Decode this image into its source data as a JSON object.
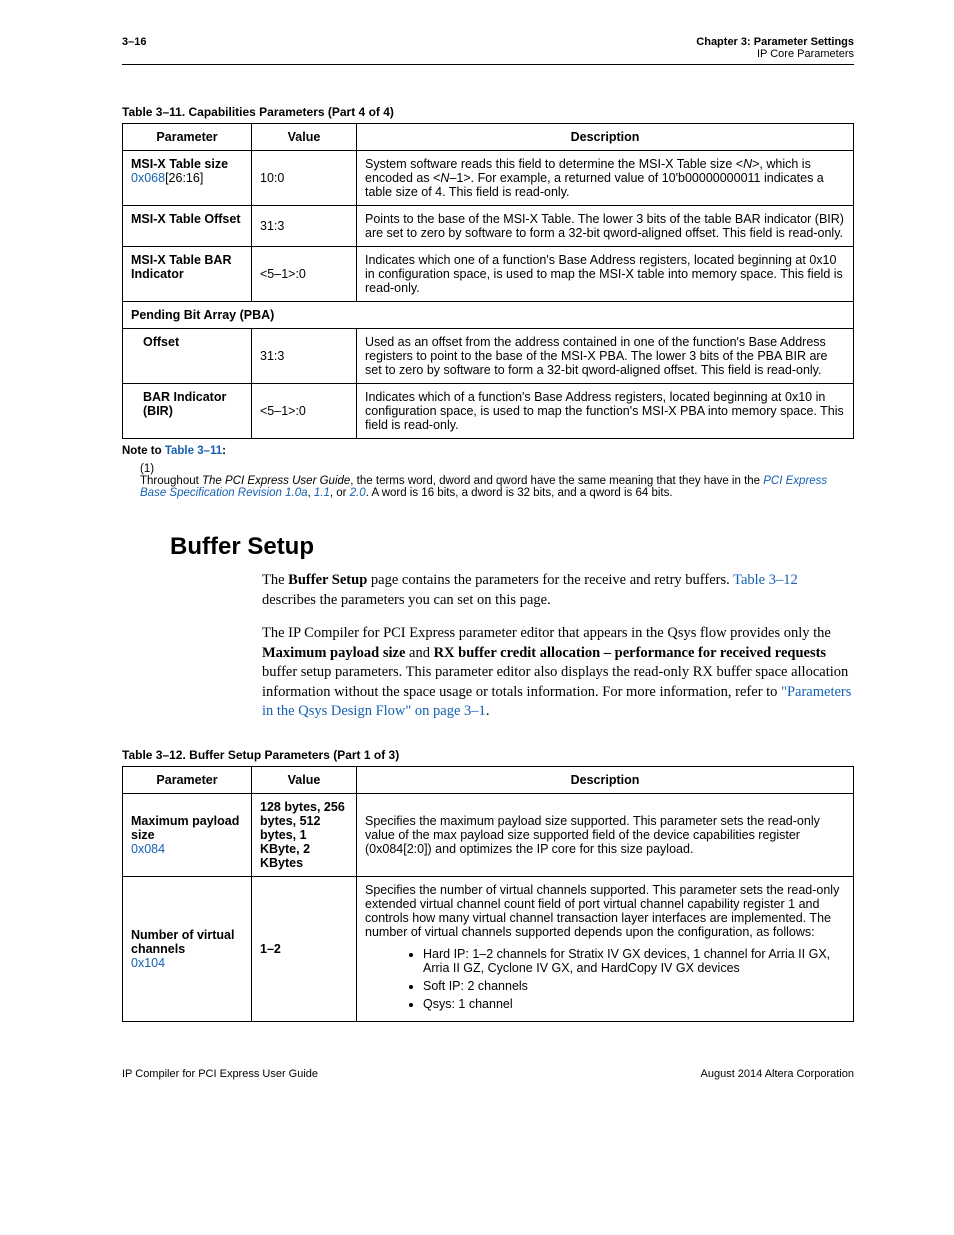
{
  "header": {
    "page_num": "3–16",
    "chapter_line": "Chapter 3:  Parameter Settings",
    "chapter_sub": "IP Core Parameters"
  },
  "table311": {
    "caption": "Table 3–11.  Capabilities Parameters   (Part 4 of 4)",
    "head_param": "Parameter",
    "head_value": "Value",
    "head_desc": "Description",
    "rows": [
      {
        "param_main": "MSI-X Table size",
        "param_sub_pre": "0x068",
        "param_sub_post": "[26:16]",
        "value": "10:0",
        "desc_pre": "System software reads this field to determine the MSI-X Table size <",
        "desc_n1": "N",
        "desc_mid1": ">, which is encoded as <",
        "desc_n2": "N",
        "desc_post": "–1>. For example, a returned value of 10'b00000000011 indicates a table size of 4. This field is read-only."
      },
      {
        "param_main": "MSI-X Table Offset",
        "value": "31:3",
        "desc": "Points to the base of the MSI-X Table. The lower 3 bits of the table BAR indicator (BIR) are set to zero by software to form a 32-bit qword-aligned offset. This field is read-only."
      },
      {
        "param_main": "MSI-X Table BAR Indicator",
        "value": "<5–1>:0",
        "desc": "Indicates which one of a function's Base Address registers, located beginning at 0x10 in configuration space, is used to map the MSI-X table into memory space. This field is read-only."
      }
    ],
    "span_row": "Pending Bit Array (PBA)",
    "rows2": [
      {
        "param_main": "Offset",
        "value": "31:3",
        "desc": "Used as an offset from the address contained in one of the function's Base Address registers to point to the base of the MSI-X PBA. The lower 3 bits of the PBA BIR are set to zero by software to form a 32-bit qword-aligned offset. This field is read-only."
      },
      {
        "param_main": "BAR Indicator (BIR)",
        "value": "<5–1>:0",
        "desc": "Indicates which of a function's Base Address registers, located beginning at 0x10 in configuration space, is used to map the function's MSI-X PBA into memory space. This field is read-only."
      }
    ]
  },
  "notes": {
    "hdr_pre": "Note to ",
    "hdr_link": "Table 3–11",
    "hdr_post": ":",
    "num": "(1)",
    "t1": "Throughout ",
    "guide_italic": "The PCI Express User Guide",
    "t2": ", the terms word, dword and qword have the same meaning that they have in the ",
    "link1": "PCI Express Base Specification Revision 1.0a",
    "t3": ", ",
    "link2": "1.1",
    "t4": ", or ",
    "link3": "2.0",
    "t5": ". A word is 16 bits, a dword is 32 bits, and a qword is 64 bits."
  },
  "section": {
    "heading": "Buffer Setup",
    "p1_a": "The ",
    "p1_b": "Buffer Setup ",
    "p1_c": " page contains the parameters for the receive and retry buffers. ",
    "p1_link": "Table 3–12",
    "p1_d": " describes the parameters you can set on this page.",
    "p2_a": "The IP Compiler for PCI Express parameter editor that appears in the Qsys flow provides only the ",
    "p2_b": "Maximum payload size",
    "p2_c": " and ",
    "p2_d": "RX buffer credit allocation – performance for received requests",
    "p2_e": " buffer setup parameters. This parameter editor also displays the read-only RX buffer space allocation information without the space usage or totals information. For more information, refer to ",
    "p2_link": "\"Parameters in the Qsys Design Flow\" on page 3–1",
    "p2_f": "."
  },
  "table312": {
    "caption": "Table 3–12.  Buffer Setup Parameters   (Part 1 of 3)",
    "head_param": "Parameter",
    "head_value": "Value",
    "head_desc": "Description",
    "rows": [
      {
        "param_main": "Maximum payload size",
        "param_link": "0x084",
        "value": "128 bytes, 256 bytes, 512 bytes, 1 KByte, 2 KBytes",
        "desc": "Specifies the maximum payload size supported. This parameter sets the read-only value of the max payload size supported field of the device capabilities register (0x084[2:0]) and optimizes the IP core for this size payload."
      },
      {
        "param_main": "Number of virtual channels",
        "param_link": "0x104",
        "value": "1–2",
        "desc_intro": "Specifies the number of virtual channels supported. This parameter sets the read-only extended virtual channel count field of port virtual channel capability register 1 and controls how many virtual channel transaction layer interfaces are implemented. The number of virtual channels supported depends upon the configuration, as follows:",
        "b1": "Hard IP: 1–2 channels for Stratix IV GX devices, 1 channel for Arria II GX, Arria II GZ, Cyclone IV GX, and HardCopy IV GX devices",
        "b2": "Soft IP: 2 channels",
        "b3": "Qsys: 1 channel"
      }
    ]
  },
  "footer": {
    "left": "IP Compiler for PCI Express User Guide",
    "right": "August 2014    Altera Corporation"
  }
}
